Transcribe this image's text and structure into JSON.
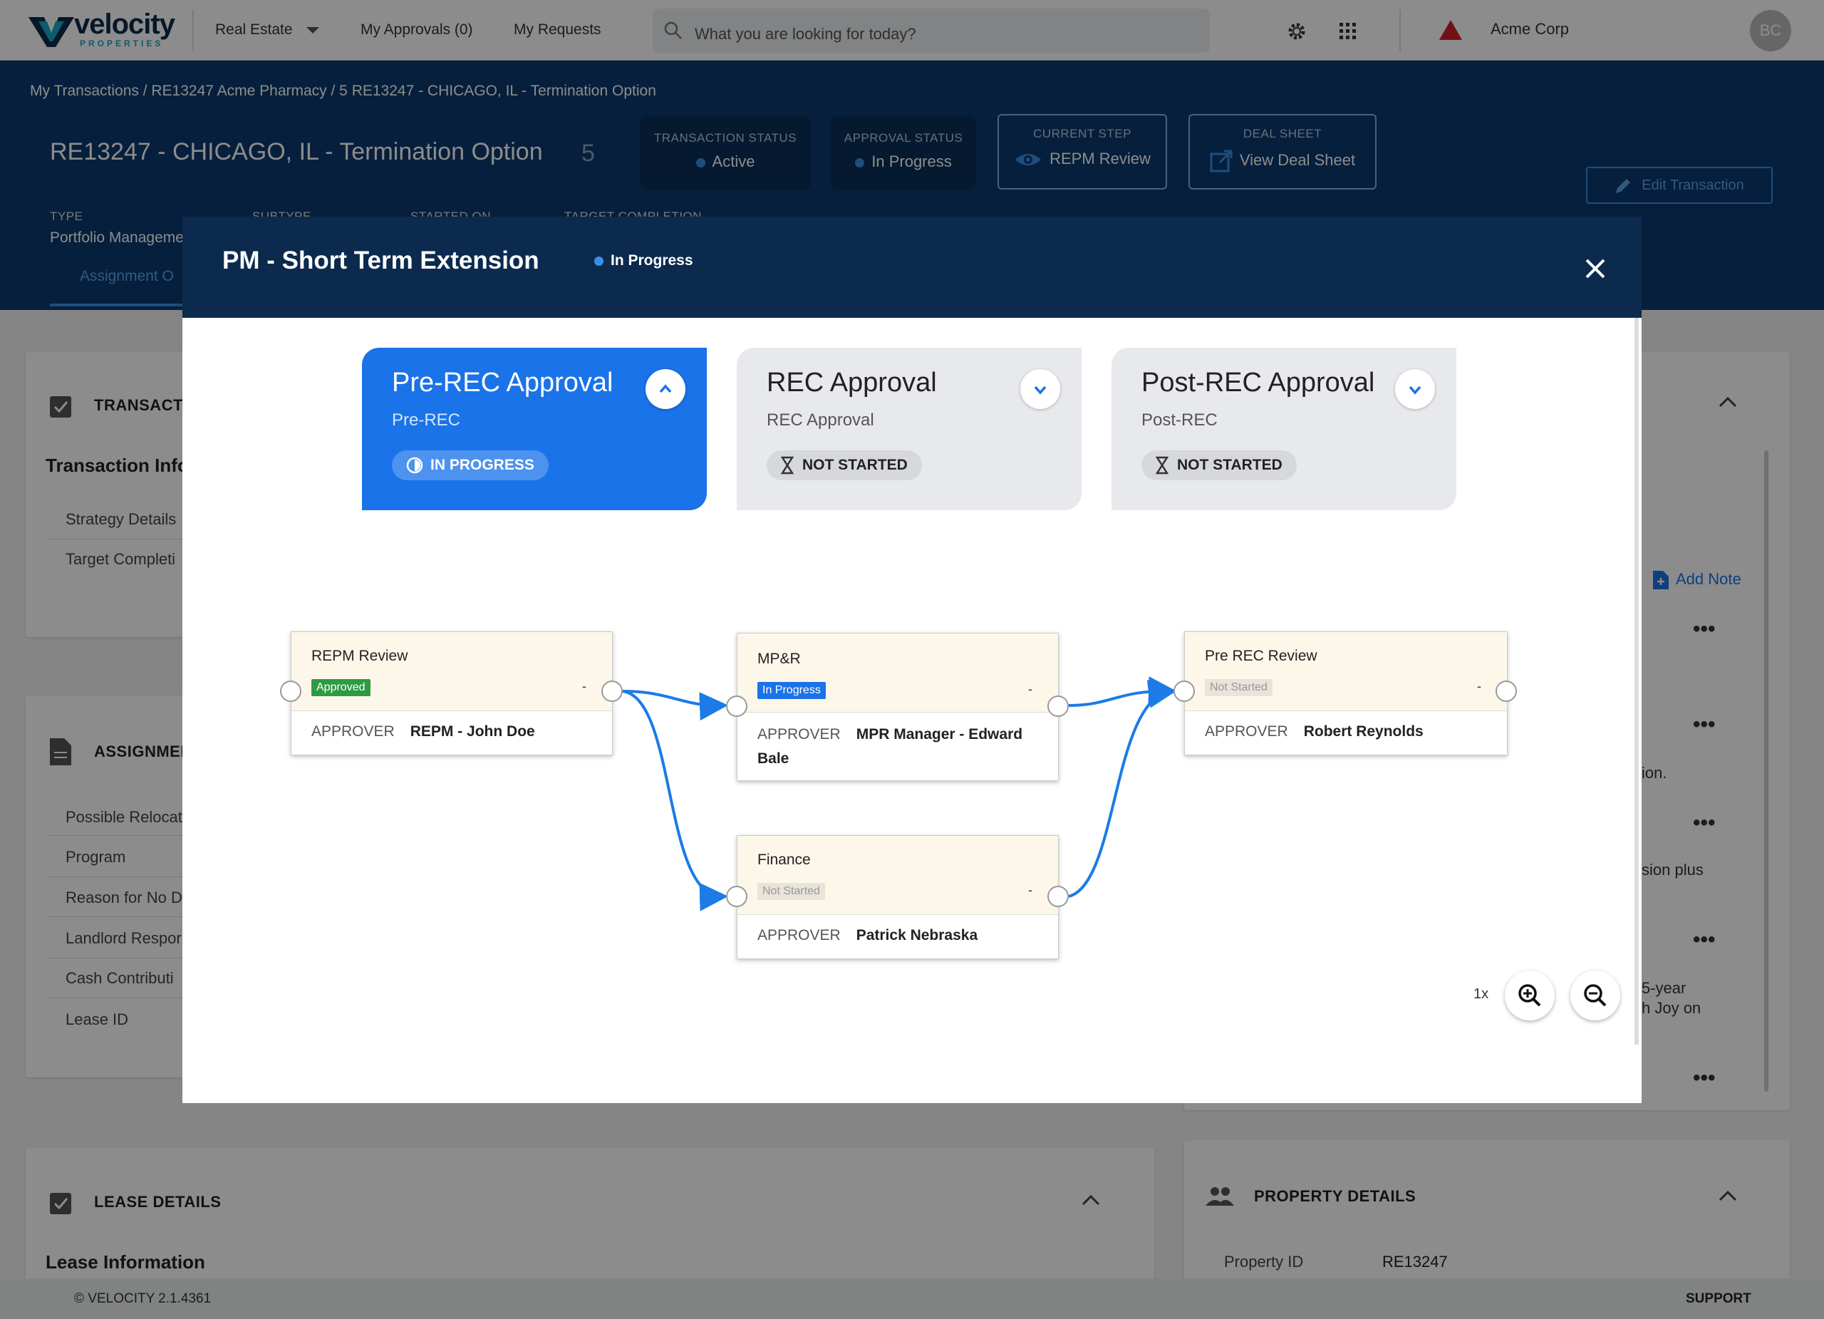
{
  "nav": {
    "logo_name": "velocity",
    "logo_sub": "PROPERTIES",
    "module": "Real Estate",
    "my_approvals": "My Approvals (0)",
    "my_requests": "My Requests",
    "search_placeholder": "What you are looking for today?",
    "company": "Acme Corp",
    "avatar_initials": "BC"
  },
  "header": {
    "breadcrumb": "My Transactions / RE13247 Acme Pharmacy / 5 RE13247 - CHICAGO, IL - Termination Option",
    "title": "RE13247 - CHICAGO, IL - Termination Option",
    "count": "5",
    "transaction_status_label": "TRANSACTION STATUS",
    "transaction_status_value": "Active",
    "approval_status_label": "APPROVAL STATUS",
    "approval_status_value": "In Progress",
    "current_step_label": "CURRENT STEP",
    "current_step_value": "REPM Review",
    "deal_sheet_label": "DEAL SHEET",
    "deal_sheet_value": "View Deal Sheet",
    "edit_button": "Edit Transaction",
    "type_label": "TYPE",
    "type_value": "Portfolio Manageme",
    "subtype_label": "SUBTYPE",
    "started_label": "STARTED ON",
    "target_label": "TARGET COMPLETION",
    "tab_assignment": "Assignment O"
  },
  "background": {
    "transaction_title": "TRANSACTI",
    "transaction_info": "Transaction Info",
    "strategy_details": "Strategy Details",
    "target_completion": "Target Completi",
    "assignment_title": "ASSIGNMEN",
    "assignment_rows": [
      "Possible Relocat",
      "Program",
      "Reason for No D",
      "Landlord Respor",
      "Cash Contributi",
      "Lease ID"
    ],
    "add_note": "Add Note",
    "note_fragments": [
      "ion.",
      "sion plus",
      "5-year",
      "h Joy on"
    ],
    "lease_details": "LEASE DETAILS",
    "lease_information": "Lease Information",
    "property_details": "PROPERTY DETAILS",
    "property_id_label": "Property ID",
    "property_id_value": "RE13247"
  },
  "modal": {
    "title": "PM - Short Term Extension",
    "status": "In Progress",
    "stages": [
      {
        "title": "Pre-REC Approval",
        "sub": "Pre-REC",
        "badge": "IN PROGRESS"
      },
      {
        "title": "REC Approval",
        "sub": "REC Approval",
        "badge": "NOT STARTED"
      },
      {
        "title": "Post-REC Approval",
        "sub": "Post-REC",
        "badge": "NOT STARTED"
      }
    ],
    "approver_label": "APPROVER",
    "nodes": [
      {
        "title": "REPM Review",
        "status": "Approved",
        "dash": "-",
        "approver": "REPM - John Doe"
      },
      {
        "title": "MP&R",
        "status": "In Progress",
        "dash": "-",
        "approver": "MPR Manager - Edward",
        "approver2": "Bale"
      },
      {
        "title": "Pre REC Review",
        "status": "Not Started",
        "dash": "-",
        "approver": "Robert Reynolds"
      },
      {
        "title": "Finance",
        "status": "Not Started",
        "dash": "-",
        "approver": "Patrick Nebraska"
      }
    ],
    "zoom_level": "1x"
  },
  "footer": {
    "version": "© VELOCITY 2.1.4361",
    "support": "SUPPORT"
  },
  "colors": {
    "brand_navy": "#0b2a4e",
    "header_blue": "#0b3a6e",
    "primary_blue": "#1a73e8",
    "flow_blue": "#1c7be6",
    "approved_green": "#2e9a44"
  }
}
